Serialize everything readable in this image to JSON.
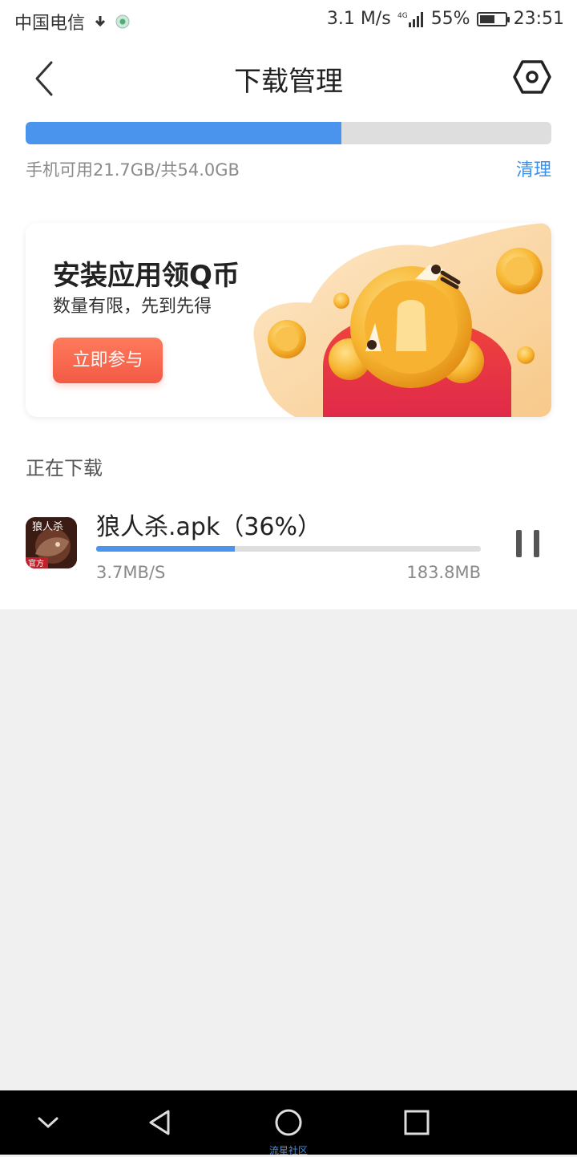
{
  "status_bar": {
    "carrier": "中国电信",
    "speed": "3.1 M/s",
    "network": "4G",
    "battery": "55%",
    "time": "23:51"
  },
  "header": {
    "title": "下载管理"
  },
  "storage": {
    "used_fraction": 0.6,
    "text": "手机可用21.7GB/共54.0GB",
    "clean_label": "清理"
  },
  "banner": {
    "title": "安装应用领Q币",
    "subtitle": "数量有限，先到先得",
    "cta_label": "立即参与"
  },
  "downloading": {
    "section_title": "正在下载",
    "items": [
      {
        "name": "狼人杀.apk（36%）",
        "progress": 0.36,
        "speed": "3.7MB/S",
        "size": "183.8MB",
        "icon_text": "狼人杀",
        "icon_badge": "官方"
      }
    ]
  },
  "colors": {
    "accent": "#4a94ee",
    "link": "#3f8fe8",
    "cta": "#f35a45"
  },
  "nav": {
    "watermark": "流星社区"
  }
}
